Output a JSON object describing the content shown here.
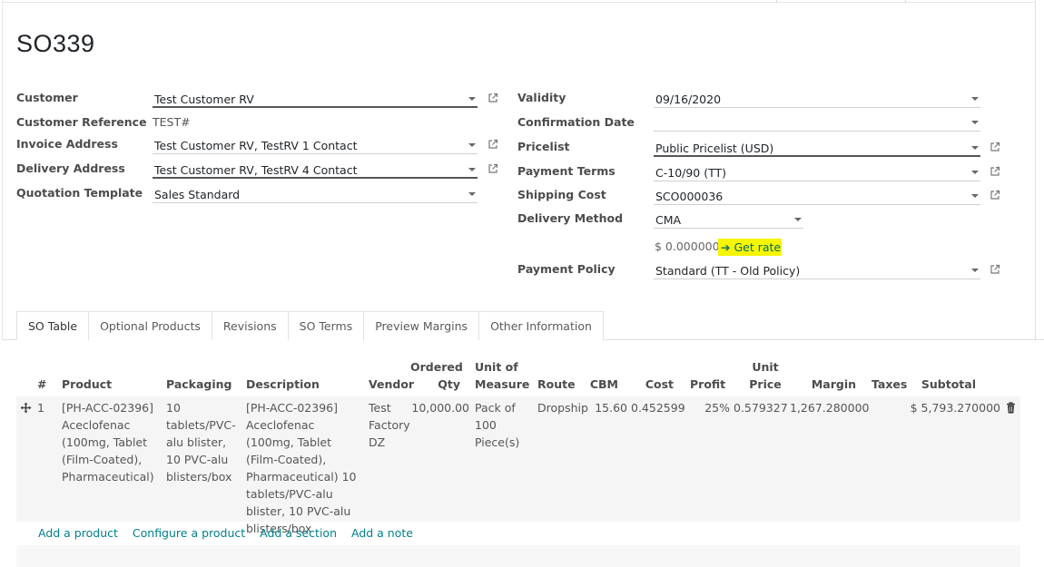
{
  "title": "SO339",
  "left_fields": [
    {
      "label": "Customer",
      "value": "Test Customer RV",
      "type": "m2o_required"
    },
    {
      "label": "Customer Reference",
      "value": "TEST#",
      "type": "text"
    },
    {
      "label": "Invoice Address",
      "value": "Test Customer RV, TestRV 1 Contact",
      "type": "m2o"
    },
    {
      "label": "Delivery Address",
      "value": "Test Customer RV, TestRV 4 Contact",
      "type": "m2o"
    },
    {
      "label": "Quotation Template",
      "value": "Sales Standard",
      "type": "select"
    }
  ],
  "right_fields": [
    {
      "label": "Validity",
      "value": "09/16/2020"
    },
    {
      "label": "Confirmation Date",
      "value": ""
    },
    {
      "label": "Pricelist",
      "value": "Public Pricelist (USD)"
    },
    {
      "label": "Payment Terms",
      "value": "C-10/90 (TT)"
    },
    {
      "label": "Shipping Cost",
      "value": "SCO000036"
    },
    {
      "label": "Delivery Method",
      "value": "CMA"
    },
    {
      "label": "Payment Policy",
      "value": "Standard (TT - Old Policy)"
    }
  ],
  "delivery_price": "$ 0.000000",
  "get_rate": {
    "arrow": "➔",
    "label": "Get rate"
  },
  "tabs": [
    "SO Table",
    "Optional Products",
    "Revisions",
    "SO Terms",
    "Preview Margins",
    "Other Information"
  ],
  "columns": {
    "num": "#",
    "product": "Product",
    "packaging": "Packaging",
    "description": "Description",
    "vendor": "Vendor",
    "ordered_qty": "Ordered Qty",
    "uom": "Unit of Measure",
    "route": "Route",
    "cbm": "CBM",
    "cost": "Cost",
    "profit": "Profit",
    "unit_price": "Unit Price",
    "margin": "Margin",
    "taxes": "Taxes",
    "subtotal": "Subtotal"
  },
  "line": {
    "num": "1",
    "product": "[PH-ACC-02396] Aceclofenac (100mg, Tablet (Film-Coated), Pharmaceutical)",
    "packaging": "10 tablets/PVC-alu blister, 10 PVC-alu blisters/box",
    "description": "[PH-ACC-02396] Aceclofenac (100mg, Tablet (Film-Coated), Pharmaceutical) 10 tablets/PVC-alu blister, 10 PVC-alu blisters/box",
    "vendor": "Test Factory DZ",
    "ordered_qty": "10,000.00",
    "uom": "Pack of 100 Piece(s)",
    "route": "Dropship",
    "cbm": "15.60",
    "cost": "0.452599",
    "profit": "25%",
    "unit_price": "0.579327",
    "margin": "1,267.280000",
    "taxes": "",
    "subtotal": "$ 5,793.270000"
  },
  "add_links": [
    "Add a product",
    "Configure a product",
    "Add a section",
    "Add a note"
  ],
  "icons": {
    "drag": "move-handle-icon",
    "delete": "trash-icon",
    "external": "external-link-icon"
  }
}
